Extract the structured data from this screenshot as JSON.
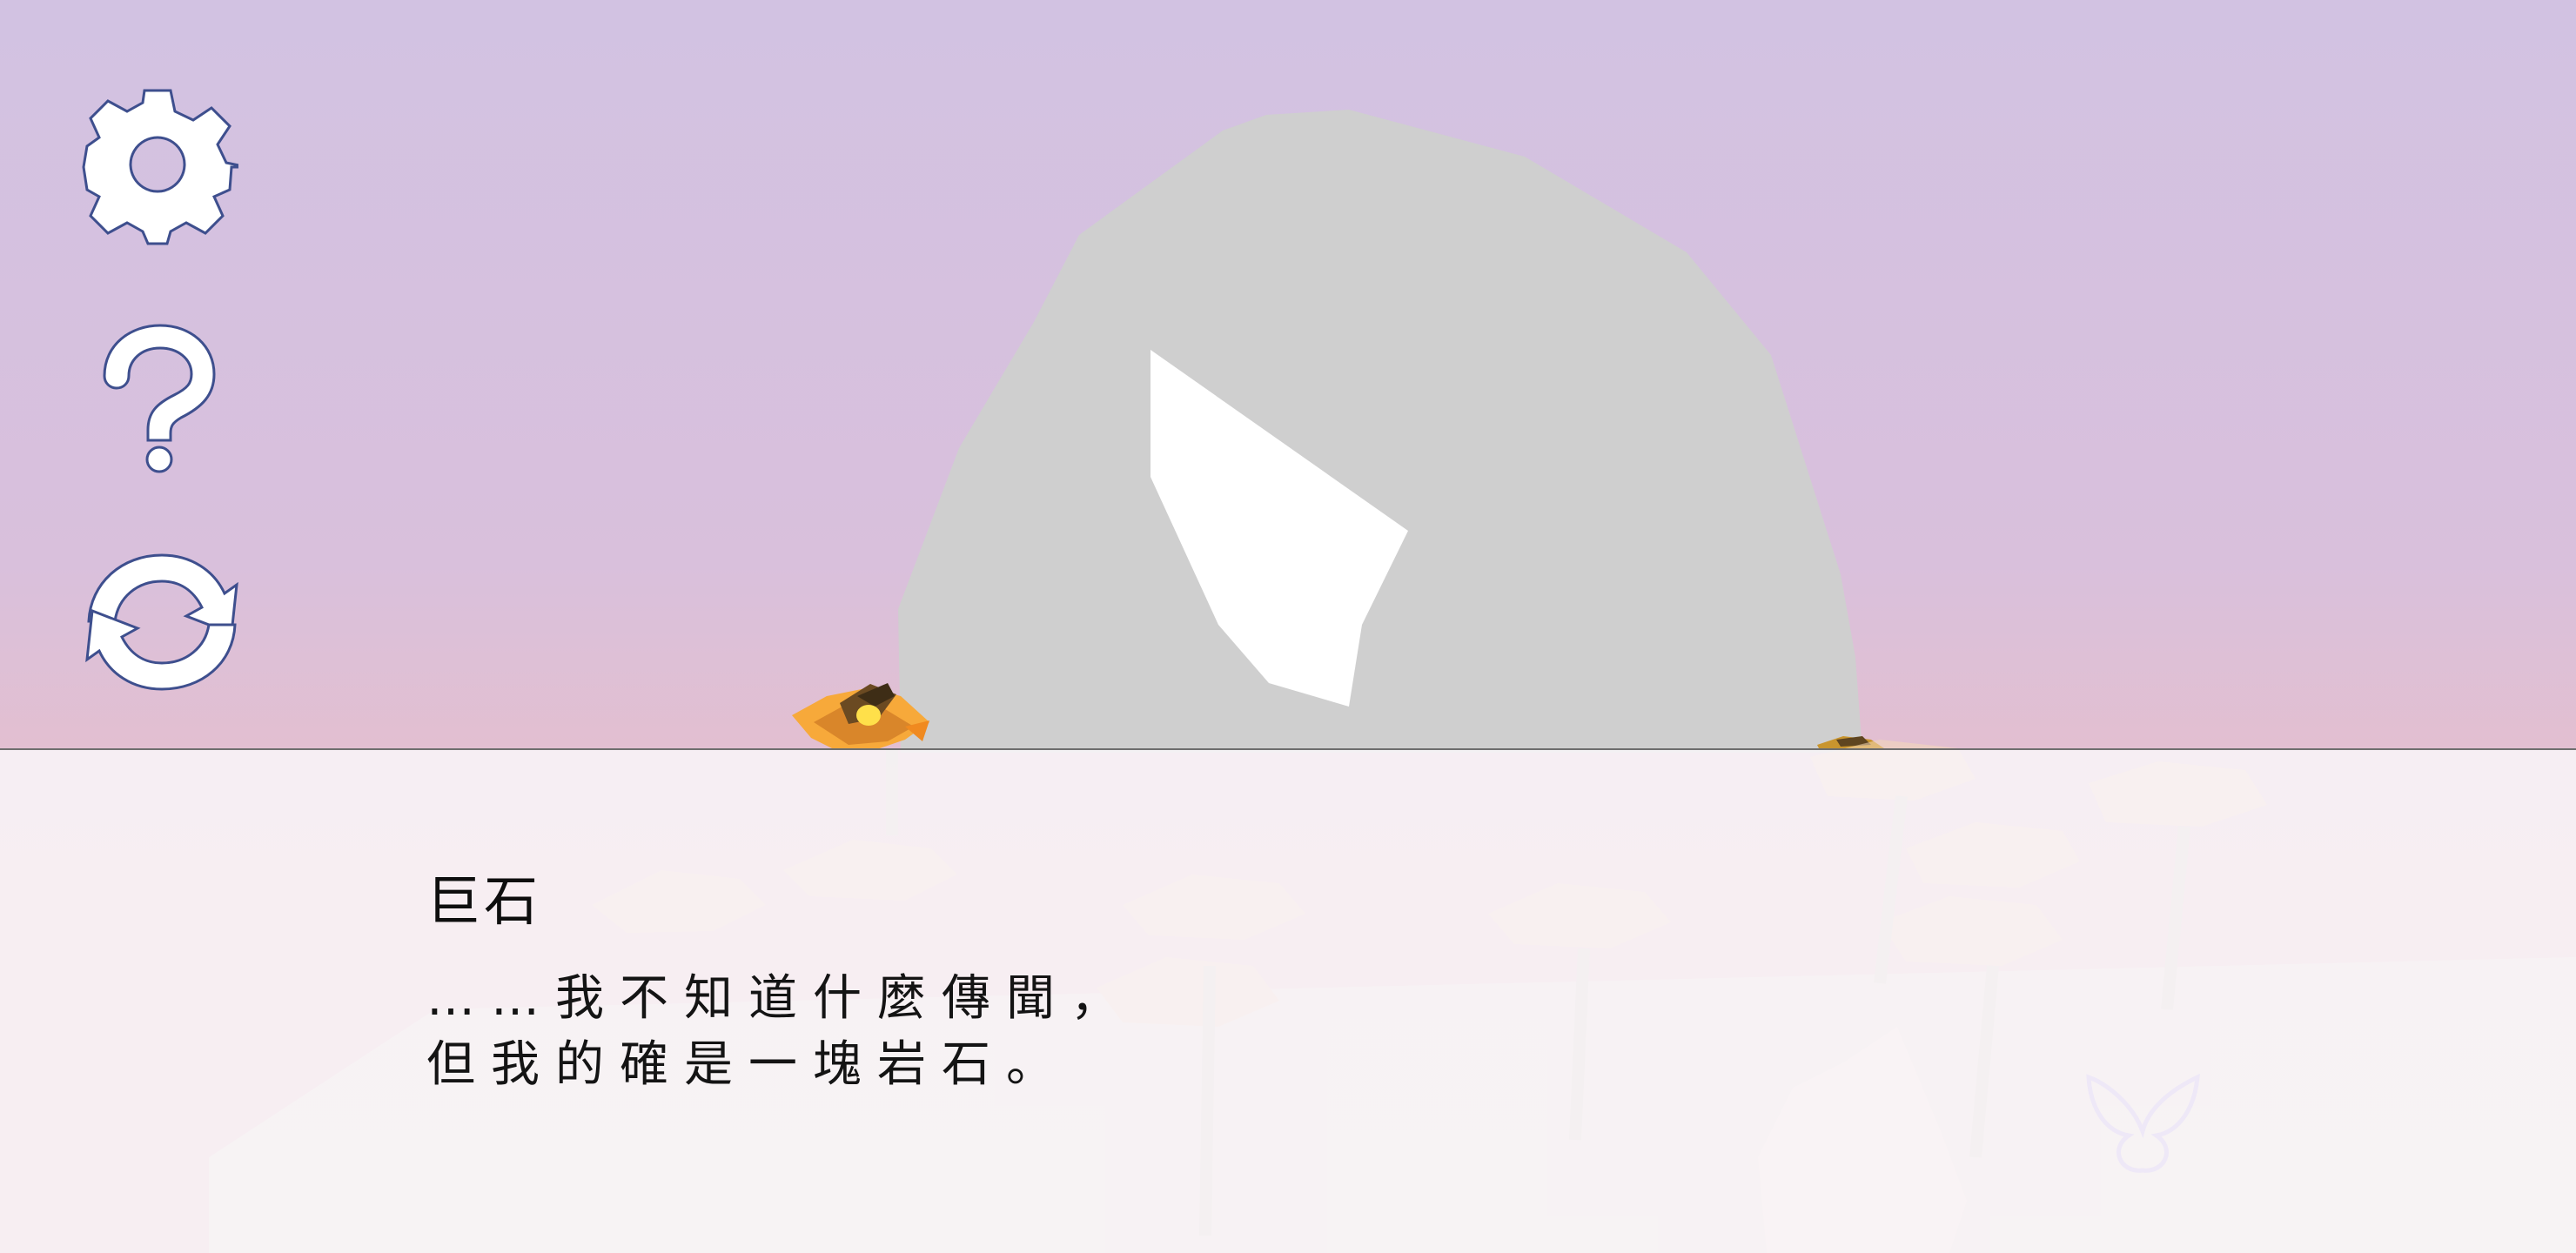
{
  "dialogue": {
    "speaker": "巨石",
    "lines": [
      "……我不知道什麼傳聞，",
      "但我的確是一塊岩石。"
    ]
  },
  "toolbar": {
    "settings_icon": "gear-icon",
    "help_icon": "question-mark-icon",
    "restart_icon": "refresh-icon"
  },
  "colors": {
    "sky_top": "#d2c2e2",
    "sky_bottom": "#e9c0cc",
    "boulder": "#cfcfcf",
    "boulder_highlight": "#ffffff",
    "button_fill": "#ffffff",
    "button_outline": "#3e4f8e",
    "flower_petal": "#f5a030",
    "flower_center": "#ffe04a",
    "butterfly_outline": "#b7a0e8",
    "dialogue_text": "#141414"
  }
}
